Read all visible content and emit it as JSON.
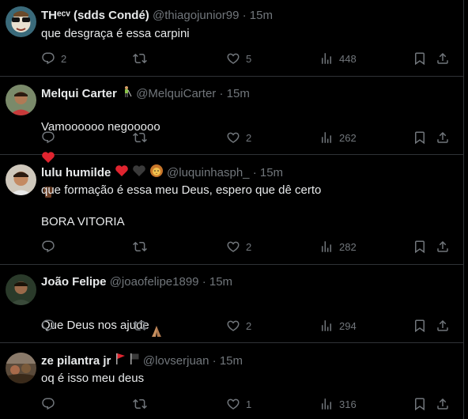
{
  "tweets": [
    {
      "display_name": "THᵉᶜᵛ (sdds Condé)",
      "handle": "@thiagojunior99",
      "separator": "·",
      "time": "15m",
      "text": "que desgraça é essa carpini",
      "replies": "2",
      "reposts": "",
      "likes": "5",
      "views": "448"
    },
    {
      "display_name": "Melqui Carter",
      "name_emoji": [
        "golfer"
      ],
      "handle": "@MelquiCarter",
      "separator": "·",
      "time": "15m",
      "text": "Vamoooooo negooooo",
      "text_emoji": [
        "red-heart",
        "raised-fist-dark"
      ],
      "replies": "",
      "reposts": "",
      "likes": "2",
      "views": "262"
    },
    {
      "display_name": "lulu humilde",
      "name_emoji": [
        "red-heart",
        "black-heart",
        "lion"
      ],
      "handle": "@luquinhasph_",
      "separator": "·",
      "time": "15m",
      "text": "que formação é essa meu Deus, espero que dê certo\n\nBORA VITORIA",
      "replies": "",
      "reposts": "",
      "likes": "2",
      "views": "282"
    },
    {
      "display_name": "João Felipe",
      "handle": "@joaofelipe1899",
      "separator": "·",
      "time": "15m",
      "text": "Que Deus nos ajude",
      "text_emoji": [
        "folded-hands"
      ],
      "replies": "",
      "reposts": "",
      "likes": "2",
      "views": "294"
    },
    {
      "display_name": "ze pilantra jr",
      "name_emoji": [
        "red-flag",
        "black-flag"
      ],
      "handle": "@lovserjuan",
      "separator": "·",
      "time": "15m",
      "text": "oq é isso meu deus",
      "replies": "",
      "reposts": "",
      "likes": "1",
      "views": "316"
    }
  ],
  "colors": {
    "background": "#000000",
    "text": "#e7e9ea",
    "secondary": "#71767b",
    "divider": "#2f3336"
  }
}
